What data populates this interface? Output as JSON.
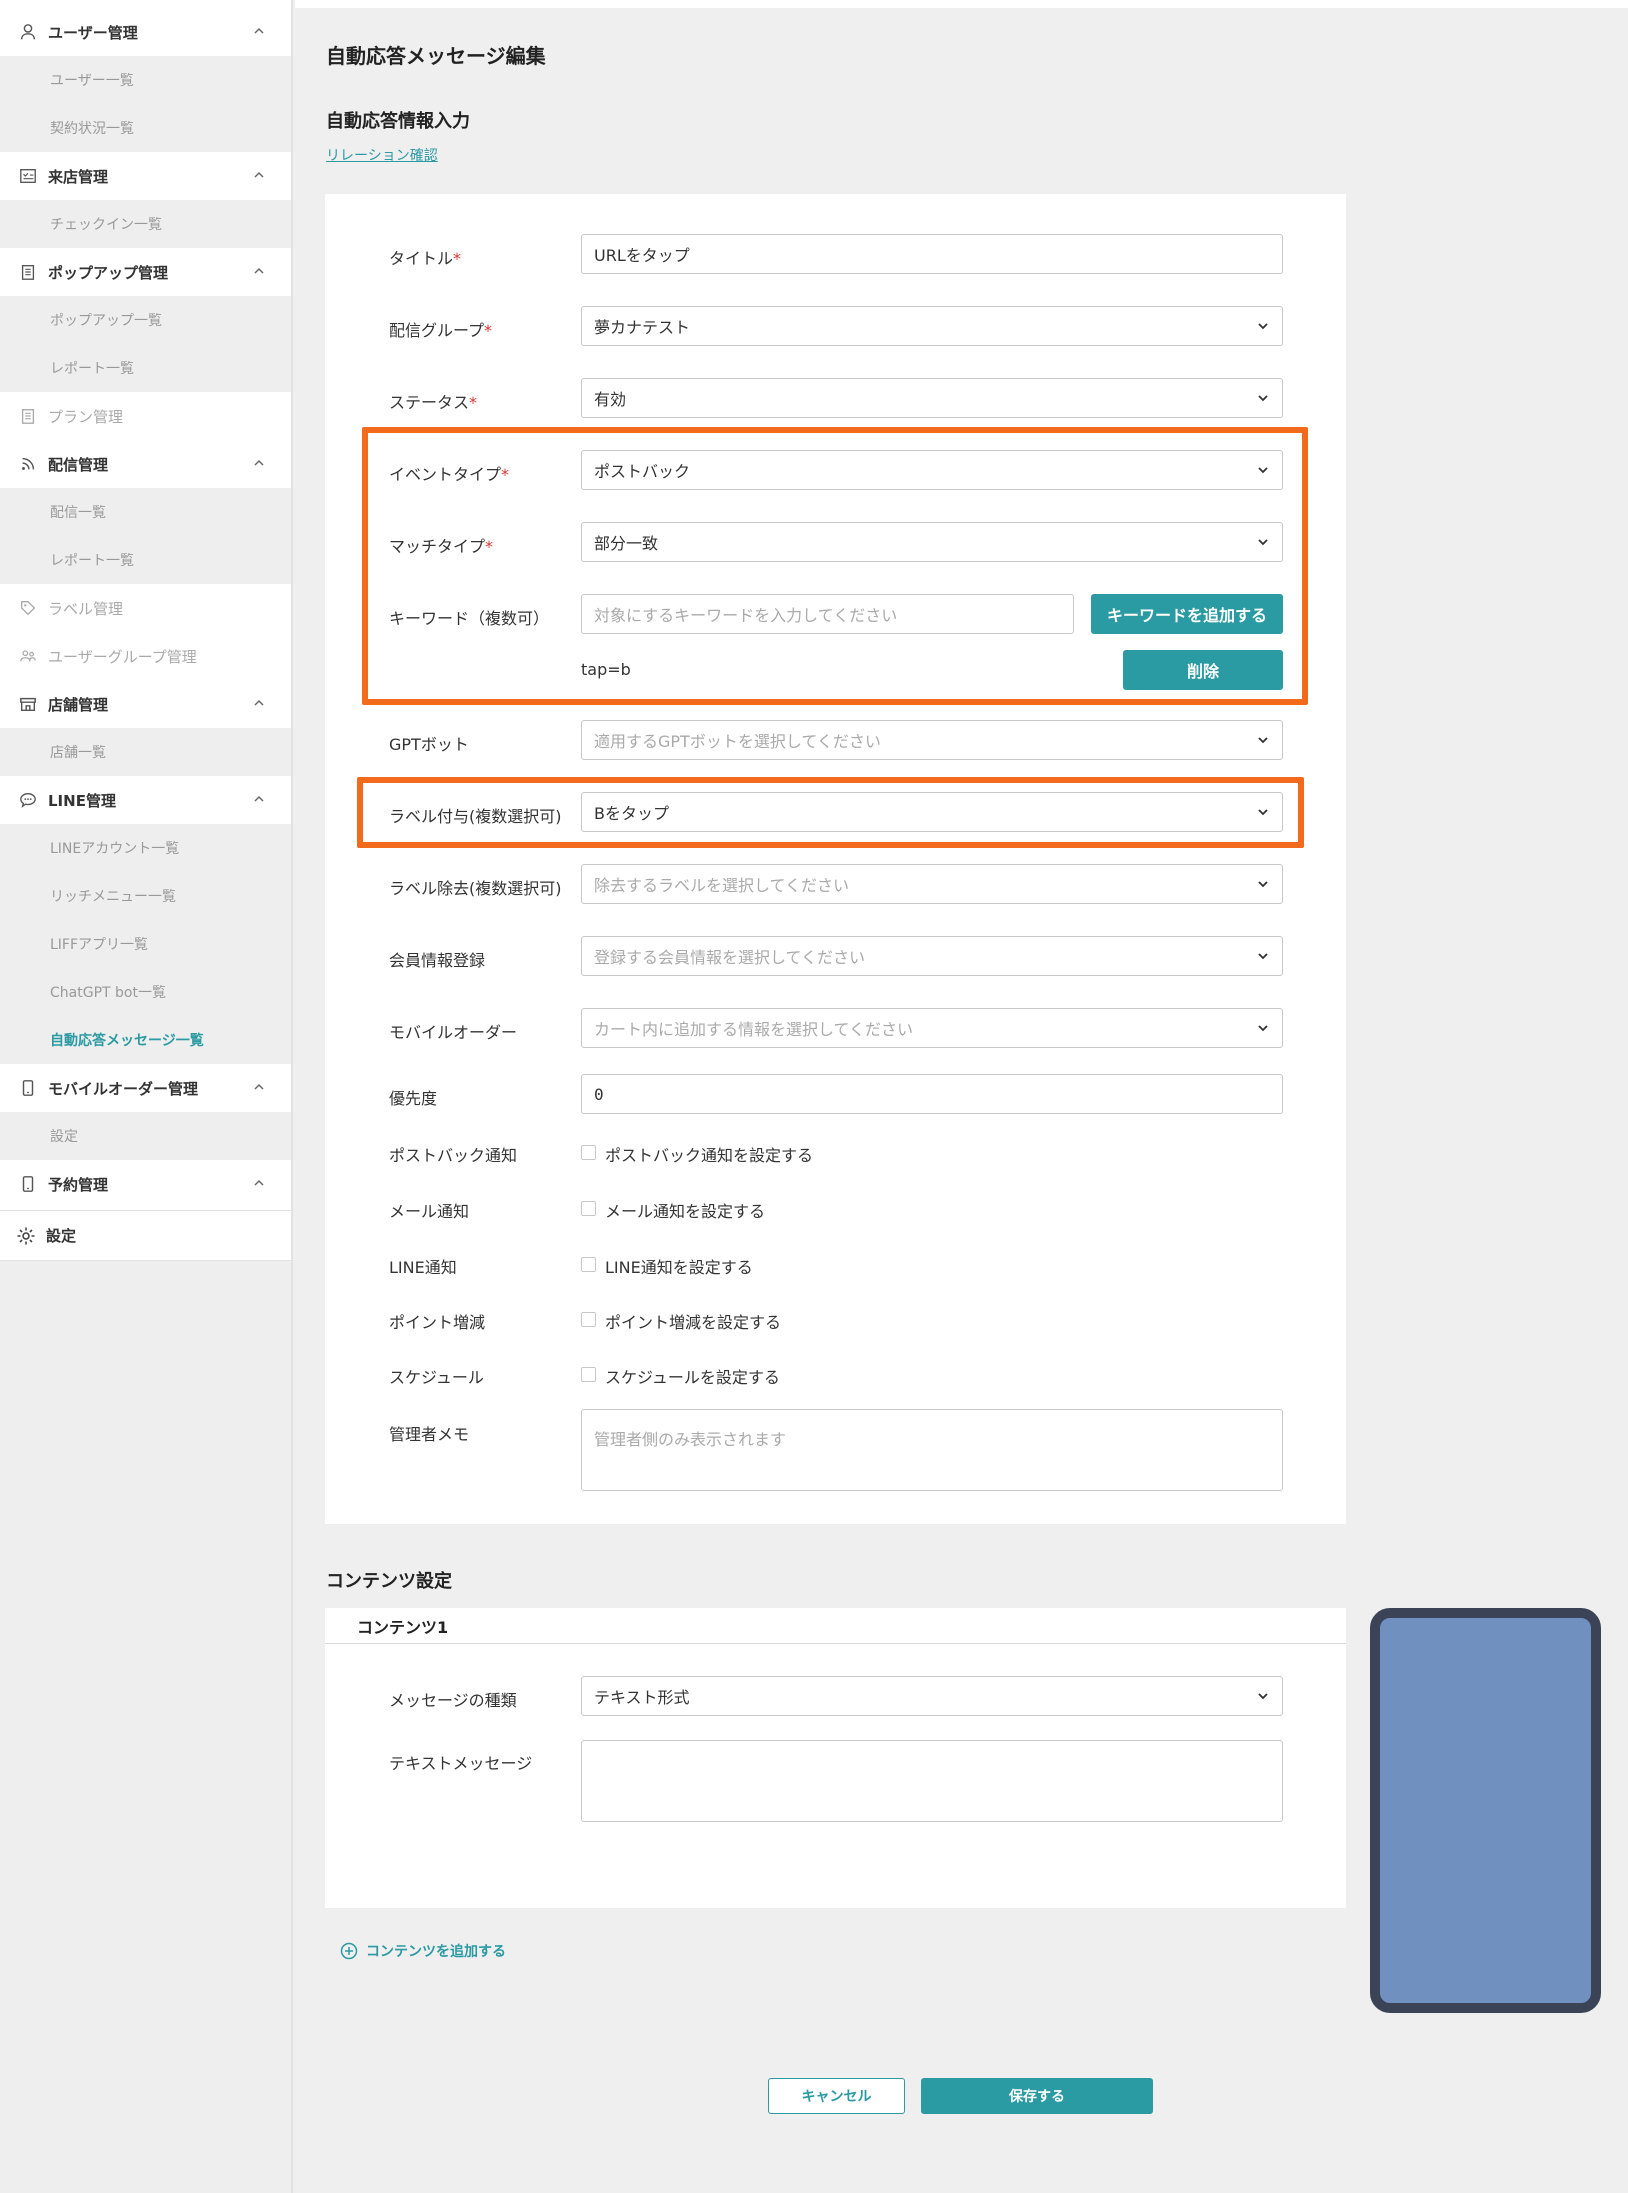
{
  "sidebar": {
    "user_mgmt": {
      "label": "ユーザー管理",
      "items": [
        "ユーザー一覧",
        "契約状況一覧"
      ]
    },
    "visit_mgmt": {
      "label": "来店管理",
      "items": [
        "チェックイン一覧"
      ]
    },
    "popup_mgmt": {
      "label": "ポップアップ管理",
      "items": [
        "ポップアップ一覧",
        "レポート一覧"
      ]
    },
    "plan_mgmt": {
      "label": "プラン管理"
    },
    "delivery_mgmt": {
      "label": "配信管理",
      "items": [
        "配信一覧",
        "レポート一覧"
      ]
    },
    "label_mgmt": {
      "label": "ラベル管理"
    },
    "usergroup_mgmt": {
      "label": "ユーザーグループ管理"
    },
    "store_mgmt": {
      "label": "店舗管理",
      "items": [
        "店舗一覧"
      ]
    },
    "line_mgmt": {
      "label": "LINE管理",
      "items": [
        "LINEアカウント一覧",
        "リッチメニュー一覧",
        "LIFFアプリ一覧",
        "ChatGPT bot一覧",
        "自動応答メッセージ一覧"
      ]
    },
    "mobile_order_mgmt": {
      "label": "モバイルオーダー管理",
      "items": [
        "設定"
      ]
    },
    "reservation_mgmt": {
      "label": "予約管理"
    },
    "settings": {
      "label": "設定"
    }
  },
  "page": {
    "title": "自動応答メッセージ編集",
    "info_section_title": "自動応答情報入力",
    "relation_link": "リレーション確認",
    "content_section_title": "コンテンツ設定"
  },
  "form": {
    "required_mark": "*",
    "title": {
      "label": "タイトル",
      "value": "URLをタップ"
    },
    "group": {
      "label": "配信グループ",
      "value": "夢カナテスト"
    },
    "status": {
      "label": "ステータス",
      "value": "有効"
    },
    "event_type": {
      "label": "イベントタイプ",
      "value": "ポストバック"
    },
    "match_type": {
      "label": "マッチタイプ",
      "value": "部分一致"
    },
    "keyword": {
      "label": "キーワード（複数可）",
      "placeholder": "対象にするキーワードを入力してください",
      "add_button": "キーワードを追加する",
      "tag": "tap=b",
      "delete_button": "削除"
    },
    "gpt_bot": {
      "label": "GPTボット",
      "placeholder": "適用するGPTボットを選択してください"
    },
    "label_add": {
      "label": "ラベル付与(複数選択可)",
      "value": "Bをタップ"
    },
    "label_remove": {
      "label": "ラベル除去(複数選択可)",
      "placeholder": "除去するラベルを選択してください"
    },
    "member_info": {
      "label": "会員情報登録",
      "placeholder": "登録する会員情報を選択してください"
    },
    "mobile_order": {
      "label": "モバイルオーダー",
      "placeholder": "カート内に追加する情報を選択してください"
    },
    "priority": {
      "label": "優先度",
      "value": "0"
    },
    "postback_notify": {
      "label": "ポストバック通知",
      "check_label": "ポストバック通知を設定する"
    },
    "mail_notify": {
      "label": "メール通知",
      "check_label": "メール通知を設定する"
    },
    "line_notify": {
      "label": "LINE通知",
      "check_label": "LINE通知を設定する"
    },
    "point": {
      "label": "ポイント増減",
      "check_label": "ポイント増減を設定する"
    },
    "schedule": {
      "label": "スケジュール",
      "check_label": "スケジュールを設定する"
    },
    "admin_memo": {
      "label": "管理者メモ",
      "placeholder": "管理者側のみ表示されます"
    }
  },
  "content": {
    "header": "コンテンツ1",
    "message_type": {
      "label": "メッセージの種類",
      "value": "テキスト形式"
    },
    "text_message": {
      "label": "テキストメッセージ",
      "value": ""
    },
    "add_content": "コンテンツを追加する"
  },
  "actions": {
    "cancel": "キャンセル",
    "save": "保存する"
  },
  "colors": {
    "accent": "#2a9aa3",
    "highlight": "#f26a1b",
    "phone_screen": "#7090c0",
    "phone_frame": "#3b4456"
  }
}
